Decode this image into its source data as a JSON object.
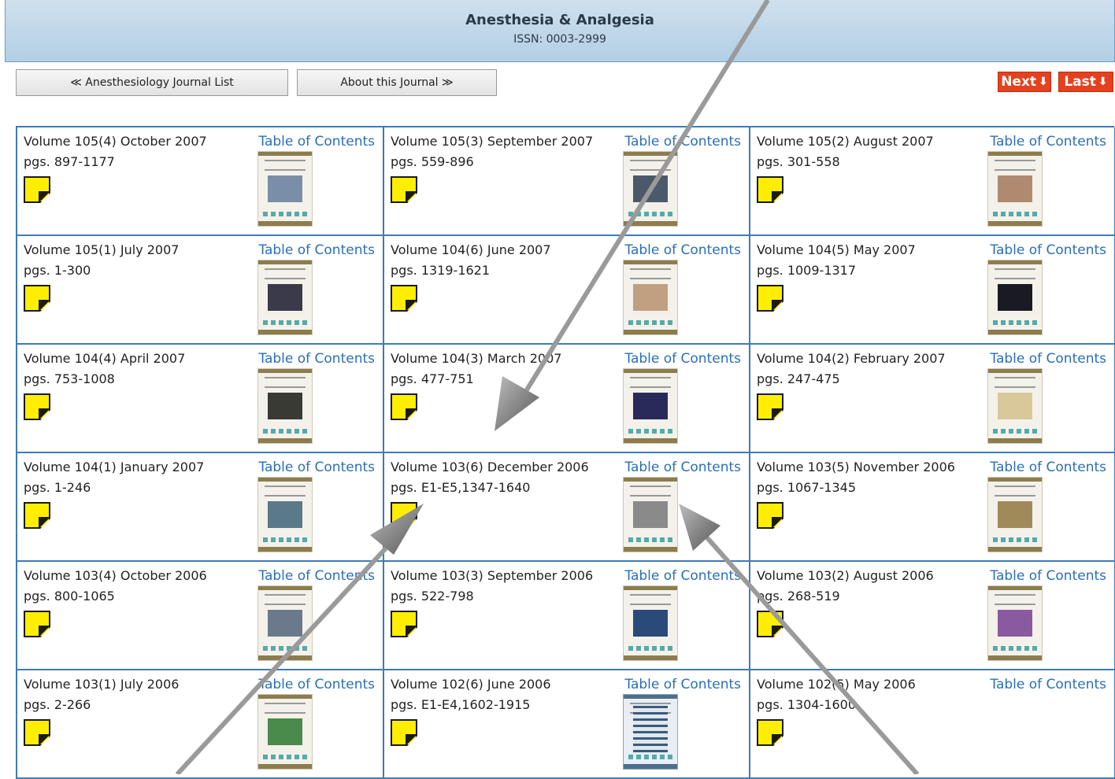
{
  "header": {
    "title": "Anesthesia & Analgesia",
    "issn": "ISSN: 0003-2999"
  },
  "nav": {
    "journal_list": "≪ Anesthesiology Journal List",
    "about": "About this Journal ≫",
    "next": "Next",
    "last": "Last"
  },
  "toc_label": "Table of Contents",
  "issues": [
    {
      "volume": "Volume 105(4) October 2007",
      "pages": "pgs. 897-1177",
      "cover": "#7a8ea8"
    },
    {
      "volume": "Volume 105(3) September 2007",
      "pages": "pgs. 559-896",
      "cover": "#4a5a6a"
    },
    {
      "volume": "Volume 105(2) August 2007",
      "pages": "pgs. 301-558",
      "cover": "#b08a70"
    },
    {
      "volume": "Volume 105(1) July 2007",
      "pages": "pgs. 1-300",
      "cover": "#3a3a4a"
    },
    {
      "volume": "Volume 104(6) June 2007",
      "pages": "pgs. 1319-1621",
      "cover": "#c0a080"
    },
    {
      "volume": "Volume 104(5) May 2007",
      "pages": "pgs. 1009-1317",
      "cover": "#1a1a22"
    },
    {
      "volume": "Volume 104(4) April 2007",
      "pages": "pgs. 753-1008",
      "cover": "#3a3a34"
    },
    {
      "volume": "Volume 104(3) March 2007",
      "pages": "pgs. 477-751",
      "cover": "#2a2a5a"
    },
    {
      "volume": "Volume 104(2) February 2007",
      "pages": "pgs. 247-475",
      "cover": "#d8c89a"
    },
    {
      "volume": "Volume 104(1) January 2007",
      "pages": "pgs. 1-246",
      "cover": "#5a7a8a"
    },
    {
      "volume": "Volume 103(6) December 2006",
      "pages": "pgs. E1-E5,1347-1640",
      "cover": "#8a8a8a"
    },
    {
      "volume": "Volume 103(5) November 2006",
      "pages": "pgs. 1067-1345",
      "cover": "#a08a5a"
    },
    {
      "volume": "Volume 103(4) October 2006",
      "pages": "pgs. 800-1065",
      "cover": "#6a7a8a"
    },
    {
      "volume": "Volume 103(3) September 2006",
      "pages": "pgs. 522-798",
      "cover": "#2a4a7a"
    },
    {
      "volume": "Volume 103(2) August 2006",
      "pages": "pgs. 268-519",
      "cover": "#8a5aa0"
    },
    {
      "volume": "Volume 103(1) July 2006",
      "pages": "pgs. 2-266",
      "cover": "#4a8a4a"
    },
    {
      "volume": "Volume 102(6) June 2006",
      "pages": "pgs. E1-E4,1602-1915",
      "cover": "#3a5a7a",
      "cover_style": "blue"
    },
    {
      "volume": "Volume 102(5) May 2006",
      "pages": "pgs. 1304-1600",
      "cover": null
    }
  ]
}
